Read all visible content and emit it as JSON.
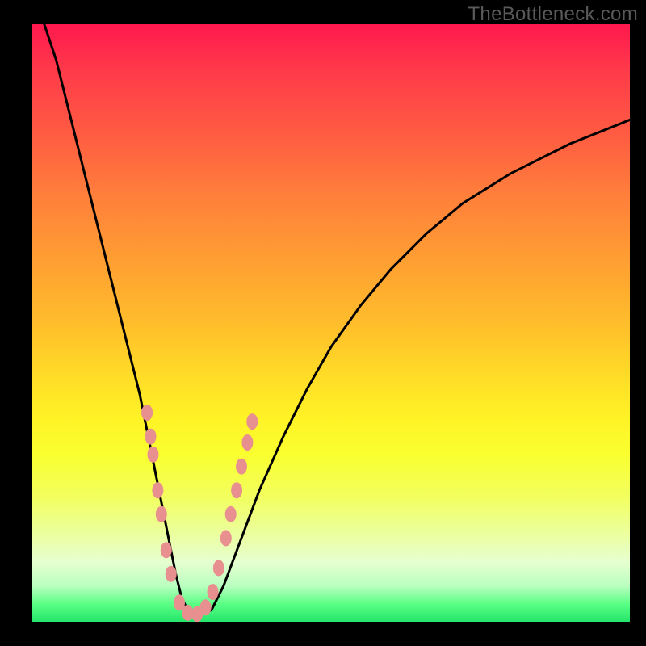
{
  "watermark": "TheBottleneck.com",
  "accent_marker_color": "#e88f8f",
  "curve_color": "#000000",
  "chart_data": {
    "type": "line",
    "title": "",
    "xlabel": "",
    "ylabel": "",
    "xlim": [
      0,
      100
    ],
    "ylim": [
      0,
      100
    ],
    "series": [
      {
        "name": "bottleneck-curve",
        "x": [
          2,
          4,
          6,
          8,
          10,
          12,
          14,
          16,
          18,
          19,
          20,
          21,
          22,
          23,
          24,
          25,
          26,
          27,
          28,
          30,
          32,
          35,
          38,
          42,
          46,
          50,
          55,
          60,
          66,
          72,
          80,
          90,
          100
        ],
        "y": [
          100,
          94,
          86,
          78,
          70,
          62,
          54,
          46,
          38,
          33,
          28,
          23,
          18,
          13,
          8,
          4,
          2,
          1,
          1,
          2,
          6,
          14,
          22,
          31,
          39,
          46,
          53,
          59,
          65,
          70,
          75,
          80,
          84
        ]
      }
    ],
    "markers": [
      {
        "x": 19.2,
        "y": 35
      },
      {
        "x": 19.8,
        "y": 31
      },
      {
        "x": 20.2,
        "y": 28
      },
      {
        "x": 21.0,
        "y": 22
      },
      {
        "x": 21.6,
        "y": 18
      },
      {
        "x": 22.4,
        "y": 12
      },
      {
        "x": 23.2,
        "y": 8
      },
      {
        "x": 24.6,
        "y": 3.2
      },
      {
        "x": 26.0,
        "y": 1.5
      },
      {
        "x": 27.6,
        "y": 1.3
      },
      {
        "x": 29.0,
        "y": 2.4
      },
      {
        "x": 30.2,
        "y": 5.0
      },
      {
        "x": 31.2,
        "y": 9.0
      },
      {
        "x": 32.4,
        "y": 14.0
      },
      {
        "x": 33.2,
        "y": 18.0
      },
      {
        "x": 34.2,
        "y": 22.0
      },
      {
        "x": 35.0,
        "y": 26.0
      },
      {
        "x": 36.0,
        "y": 30.0
      },
      {
        "x": 36.8,
        "y": 33.5
      }
    ]
  }
}
